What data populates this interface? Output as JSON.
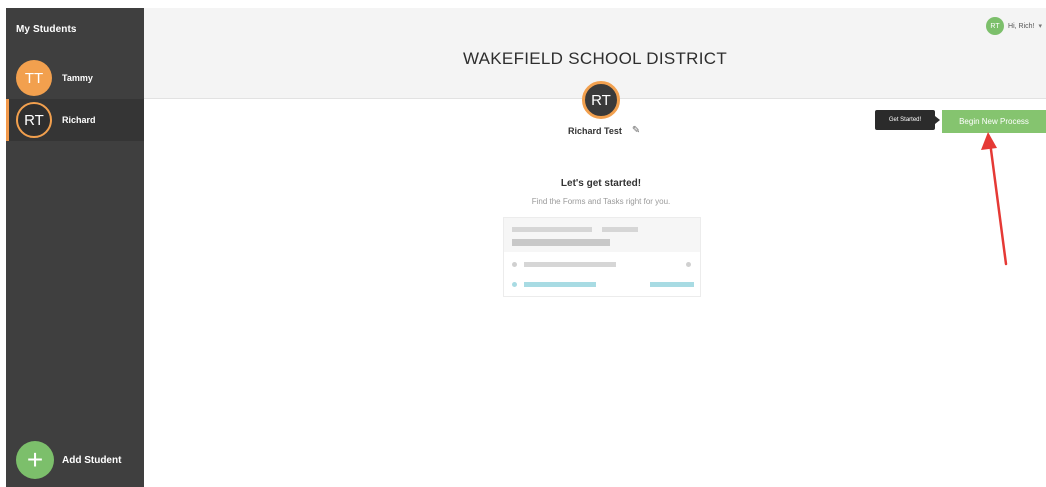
{
  "sidebar": {
    "title": "My Students",
    "students": [
      {
        "initials": "TT",
        "name": "Tammy",
        "selected": false
      },
      {
        "initials": "RT",
        "name": "Richard",
        "selected": true
      }
    ],
    "add_label": "Add Student",
    "add_symbol": "+"
  },
  "header": {
    "district": "WAKEFIELD SCHOOL DISTRICT",
    "user_initials": "RT",
    "user_greeting": "Hi, Rich!",
    "chevron": "▾"
  },
  "profile": {
    "initials": "RT",
    "name": "Richard Test",
    "edit_glyph": "✎"
  },
  "actions": {
    "tooltip": "Get Started!",
    "begin_button": "Begin New Process"
  },
  "empty_state": {
    "title": "Let's get started!",
    "subtitle": "Find the Forms and Tasks right for you."
  },
  "colors": {
    "sidebar": "#3f3f3f",
    "accent_orange": "#f2a04e",
    "accent_green": "#85c46f",
    "annotation_red": "#e53935"
  },
  "icons": {
    "edit": "pencil-icon",
    "add": "plus-icon",
    "user_menu": "chevron-down-icon"
  }
}
